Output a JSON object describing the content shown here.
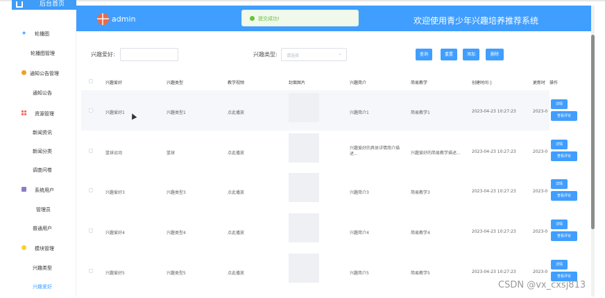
{
  "sidebar": {
    "logo_text": "后台首页",
    "items": [
      {
        "label": "轮播图",
        "icon": "star-icon",
        "level": 1
      },
      {
        "label": "轮播图管理",
        "level": 2
      },
      {
        "label": "通知公告管理",
        "icon": "dot-orange-icon",
        "level": 1
      },
      {
        "label": "通知公告",
        "level": 2
      },
      {
        "label": "资源管理",
        "icon": "grid-icon",
        "level": 1
      },
      {
        "label": "新闻资讯",
        "level": 2
      },
      {
        "label": "新闻分类",
        "level": 2
      },
      {
        "label": "调查问卷",
        "level": 2
      },
      {
        "label": "系统用户",
        "icon": "server-icon",
        "level": 1
      },
      {
        "label": "管理员",
        "level": 2
      },
      {
        "label": "普通用户",
        "level": 2
      },
      {
        "label": "模块管理",
        "icon": "dot-yellow-icon",
        "level": 1
      },
      {
        "label": "兴趣类型",
        "level": 2
      },
      {
        "label": "兴趣爱好",
        "level": 2,
        "active": true
      }
    ]
  },
  "header": {
    "admin_name": "admin",
    "system_title": "欢迎使用青少年兴趣培养推荐系统",
    "toast_text": "提交成功!"
  },
  "filters": {
    "hobby_label": "兴趣爱好:",
    "type_label": "兴趣类型:",
    "type_placeholder": "请选择",
    "buttons": {
      "search": "查询",
      "reset": "重置",
      "add": "添加",
      "delete": "删除"
    }
  },
  "table": {
    "headers": [
      "兴趣爱好",
      "兴趣类型",
      "教学视频",
      "封面图片",
      "兴趣简介",
      "简易教学",
      "创建时间 ◊",
      "更新时",
      "操作"
    ],
    "rows": [
      {
        "hobby": "兴趣爱好1",
        "type": "兴趣类型1",
        "video": "点此播放",
        "intro": "兴趣简介1",
        "teach": "简易教学1",
        "created": "2023-04-23 10:27:23",
        "updated": "2023-0",
        "detail": "详情",
        "review": "查看评论"
      },
      {
        "hobby": "篮球运动",
        "type": "篮球",
        "video": "点此播放",
        "intro": "兴趣爱好的具体详情简介描述...",
        "teach": "兴趣爱好的简易教学描述...",
        "created": "2023-04-23 10:27:23",
        "updated": "2023-0",
        "detail": "详情",
        "review": "查看评论"
      },
      {
        "hobby": "兴趣爱好3",
        "type": "兴趣类型3",
        "video": "点此播放",
        "intro": "兴趣简介3",
        "teach": "简易教学3",
        "created": "2023-04-23 10:27:23",
        "updated": "2023-0",
        "detail": "详情",
        "review": "查看评论"
      },
      {
        "hobby": "兴趣爱好4",
        "type": "兴趣类型4",
        "video": "点此播放",
        "intro": "兴趣简介4",
        "teach": "简易教学4",
        "created": "2023-04-23 10:27:23",
        "updated": "2023-0",
        "detail": "详情",
        "review": "查看评论"
      },
      {
        "hobby": "兴趣爱好5",
        "type": "兴趣类型5",
        "video": "点此播放",
        "intro": "兴趣简介5",
        "teach": "简易教学5",
        "created": "2023-04-23 10:27:23",
        "updated": "2023-0",
        "detail": "详情",
        "review": "查看评论"
      }
    ]
  },
  "watermark": "CSDN @vx_cxsj813",
  "colors": {
    "primary": "#409eff",
    "success": "#67c23a"
  }
}
